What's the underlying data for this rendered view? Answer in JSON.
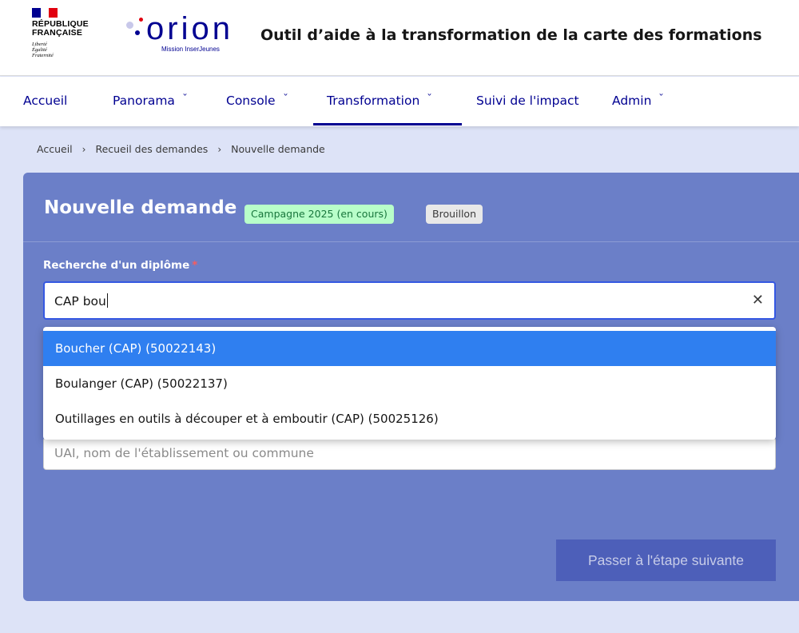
{
  "header": {
    "rf_logo_lines": [
      "RÉPUBLIQUE",
      "FRANÇAISE"
    ],
    "rf_motto": [
      "Liberté",
      "Égalité",
      "Fraternité"
    ],
    "orion_name": "orion",
    "orion_subtitle": "Mission InserJeunes",
    "app_title": "Outil d’aide à la transformation de la carte des formations",
    "colors": {
      "primary": "#000091",
      "flag_blue": "#000091",
      "flag_white": "#ffffff",
      "flag_red": "#e1000f"
    }
  },
  "nav": {
    "items": [
      {
        "label": "Accueil",
        "has_dropdown": false
      },
      {
        "label": "Panorama",
        "has_dropdown": true
      },
      {
        "label": "Console",
        "has_dropdown": true
      },
      {
        "label": "Transformation",
        "has_dropdown": true,
        "active": true
      },
      {
        "label": "Suivi de l'impact",
        "has_dropdown": false
      },
      {
        "label": "Admin",
        "has_dropdown": true
      }
    ],
    "chevron_icon": "chevron-down-icon"
  },
  "breadcrumb": {
    "items": [
      "Accueil",
      "Recueil des demandes",
      "Nouvelle demande"
    ],
    "separator_icon": "chevron-right-icon"
  },
  "form": {
    "title": "Nouvelle demande",
    "campaign_badge": "Campagne 2025 (en cours)",
    "status_badge": "Brouillon",
    "diplome_label": "Recherche d'un diplôme",
    "required_marker": "*",
    "diplome_value": "CAP bou",
    "clear_icon": "close-icon",
    "etablissement_placeholder": "UAI, nom de l'établissement ou commune",
    "next_button": "Passer à l'étape suivante"
  },
  "dropdown": {
    "options": [
      {
        "label": "Boucher (CAP) (50022143)",
        "highlighted": true
      },
      {
        "label": "Boulanger (CAP) (50022137)",
        "highlighted": false
      },
      {
        "label": "Outillages en outils à découper et à emboutir (CAP) (50025126)",
        "highlighted": false
      }
    ]
  }
}
